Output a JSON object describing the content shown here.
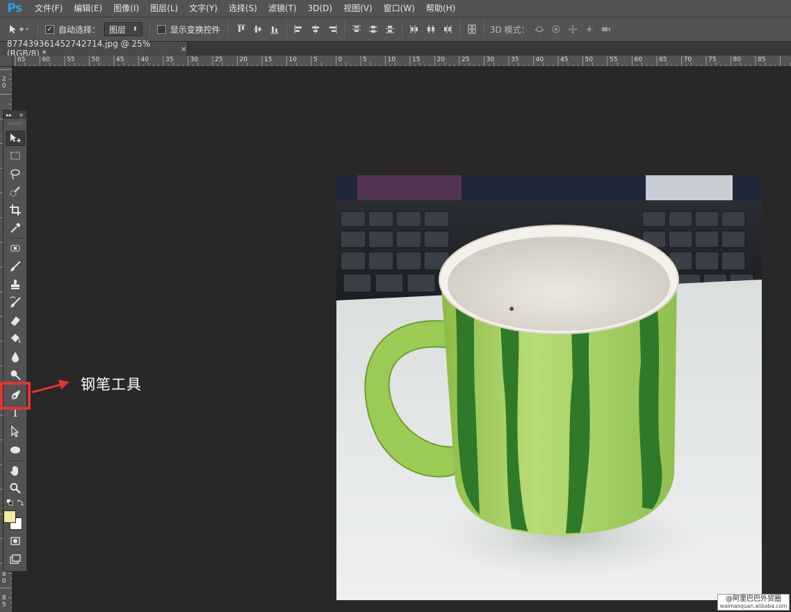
{
  "app": {
    "logo": "Ps"
  },
  "menu": [
    "文件(F)",
    "编辑(E)",
    "图像(I)",
    "图层(L)",
    "文字(Y)",
    "选择(S)",
    "滤镜(T)",
    "3D(D)",
    "视图(V)",
    "窗口(W)",
    "帮助(H)"
  ],
  "options": {
    "auto_select_label": "自动选择：",
    "auto_select_checked": "✓",
    "layer_select_value": "图层",
    "show_transform_label": "显示变换控件",
    "mode_3d_label": "3D 模式："
  },
  "document": {
    "tab_title": "877439361452742714.jpg @ 25%(RGB/8) *",
    "close": "×"
  },
  "rulers": {
    "h_labels": [
      "65",
      "60",
      "55",
      "50",
      "45",
      "40",
      "35",
      "30",
      "25",
      "20",
      "15",
      "10",
      "5",
      "0",
      "5",
      "10",
      "15",
      "20",
      "25",
      "30",
      "35",
      "40",
      "45",
      "50",
      "55",
      "60",
      "65",
      "70",
      "75",
      "80",
      "85"
    ],
    "v_top": [
      "2",
      "0"
    ],
    "v_bottom": [
      "8",
      "0",
      "8",
      "5"
    ]
  },
  "toolbox": {
    "header_expand": "▸▸",
    "header_close": "×",
    "tools": [
      "move",
      "marquee",
      "lasso",
      "quick-select",
      "crop",
      "eyedropper",
      "healing",
      "brush",
      "stamp",
      "history-brush",
      "eraser",
      "paint-bucket",
      "blur",
      "dodge",
      "pen",
      "type",
      "path-select",
      "ellipse",
      "hand",
      "zoom"
    ],
    "active_tool": "move",
    "highlighted_tool": "pen",
    "type_glyph": "T",
    "foreground_color": "#f2e9a0",
    "background_color": "#ffffff"
  },
  "annotation": {
    "text": "钢笔工具",
    "color": "#e8322f"
  },
  "watermark": {
    "cn": "@阿里巴巴外贸圈",
    "en": "waimaoquan.alibaba.com"
  }
}
